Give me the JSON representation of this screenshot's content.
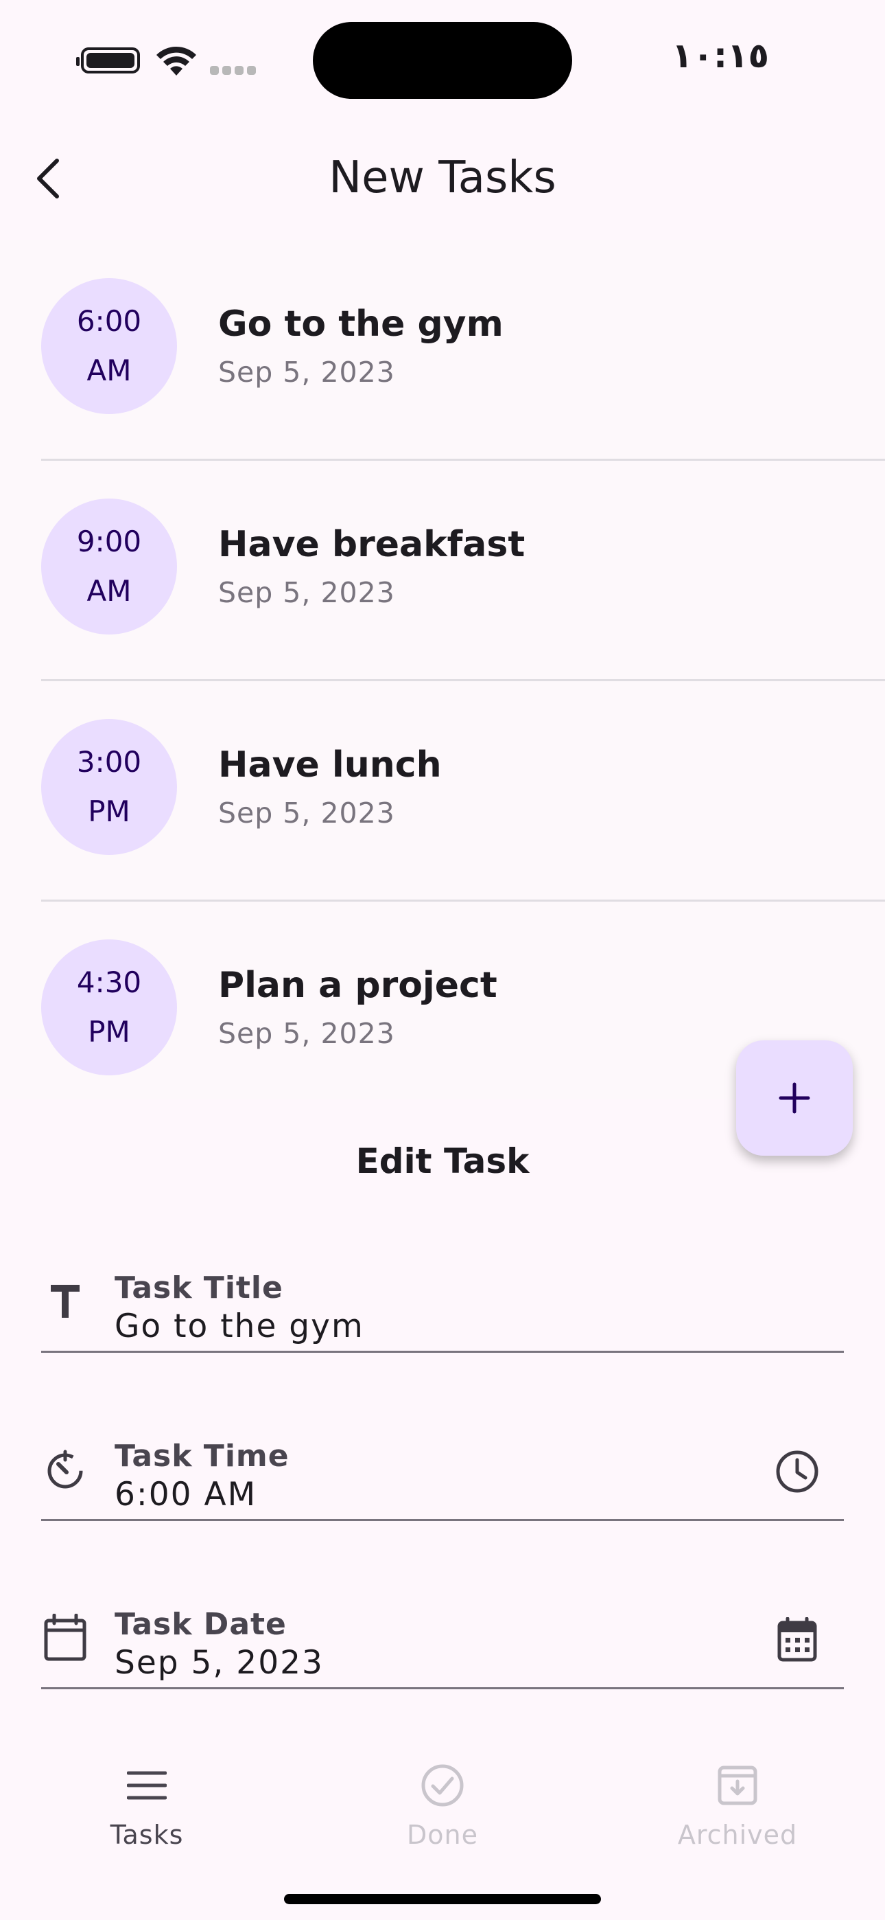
{
  "status_bar": {
    "time": "١٠:١٥"
  },
  "header": {
    "title": "New Tasks",
    "back_icon": "chevron-left-icon"
  },
  "tasks": [
    {
      "time_line1": "6:00",
      "time_line2": "AM",
      "title": "Go to the gym",
      "date": "Sep 5, 2023"
    },
    {
      "time_line1": "9:00",
      "time_line2": "AM",
      "title": "Have breakfast",
      "date": "Sep 5, 2023"
    },
    {
      "time_line1": "3:00",
      "time_line2": "PM",
      "title": "Have lunch",
      "date": "Sep 5, 2023"
    },
    {
      "time_line1": "4:30",
      "time_line2": "PM",
      "title": "Plan a project",
      "date": "Sep 5, 2023"
    }
  ],
  "fab": {
    "icon": "plus-icon"
  },
  "edit_sheet": {
    "title": "Edit Task",
    "fields": [
      {
        "label": "Task Title",
        "value": "Go to the gym",
        "icon": "text-format-icon"
      },
      {
        "label": "Task Time",
        "value": "6:00 AM",
        "icon": "timer-icon",
        "trailing_icon": "clock-icon"
      },
      {
        "label": "Task Date",
        "value": "Sep 5, 2023",
        "icon": "calendar-icon",
        "trailing_icon": "calendar-month-icon"
      }
    ]
  },
  "bottom_nav": {
    "items": [
      {
        "label": "Tasks",
        "icon": "menu-icon",
        "active": true
      },
      {
        "label": "Done",
        "icon": "check-circle-icon",
        "active": false
      },
      {
        "label": "Archived",
        "icon": "archive-icon",
        "active": false
      }
    ]
  },
  "colors": {
    "background": "#fef7fc",
    "avatar_bg": "#eaddff",
    "avatar_text": "#21005d",
    "primary_text": "#1d1b20",
    "secondary_text": "#79747e",
    "nav_active": "#49454f",
    "nav_inactive": "#c9c5cc"
  }
}
